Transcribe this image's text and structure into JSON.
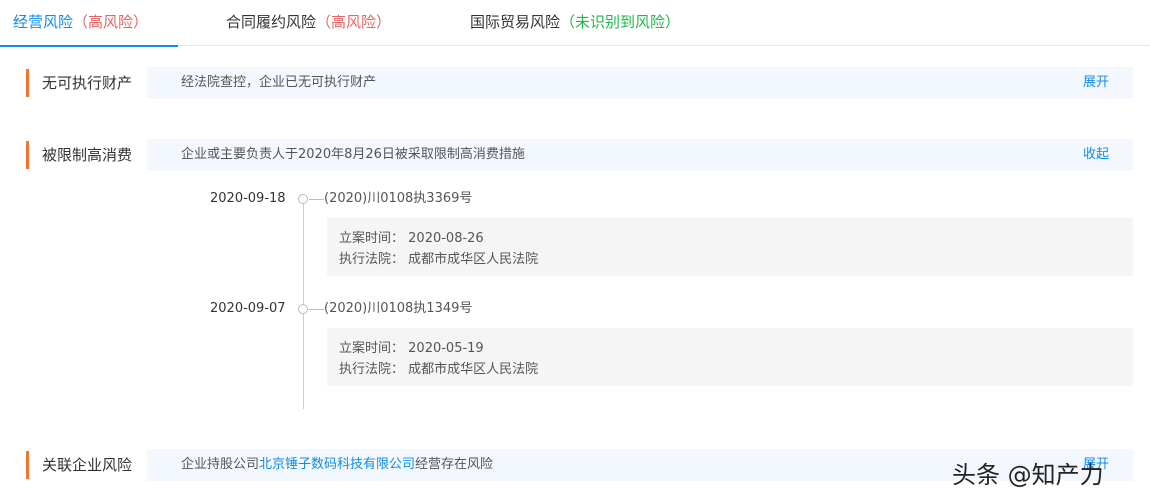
{
  "tabs": [
    {
      "label": "经营风险",
      "status": "（高风险）"
    },
    {
      "label": "合同履约风险",
      "status": "（高风险）"
    },
    {
      "label": "国际贸易风险",
      "status": "（未识别到风险）"
    }
  ],
  "sections": {
    "no_assets": {
      "title": "无可执行财产",
      "summary": "经法院查控，企业已无可执行财产",
      "toggle": "展开"
    },
    "consumption_limit": {
      "title": "被限制高消费",
      "summary": "企业或主要负责人于2020年8月26日被采取限制高消费措施",
      "toggle": "收起",
      "records": [
        {
          "date": "2020-09-18",
          "case_no": "(2020)川0108执3369号",
          "filing_label": "立案时间：",
          "filing_date": "2020-08-26",
          "court_label": "执行法院：",
          "court": "成都市成华区人民法院"
        },
        {
          "date": "2020-09-07",
          "case_no": "(2020)川0108执1349号",
          "filing_label": "立案时间：",
          "filing_date": "2020-05-19",
          "court_label": "执行法院：",
          "court": "成都市成华区人民法院"
        }
      ]
    },
    "related": {
      "title": "关联企业风险",
      "summary_prefix": "企业持股公司",
      "company": "北京锤子数码科技有限公司",
      "summary_suffix": "经营存在风险",
      "toggle": "展开"
    }
  },
  "watermark": "头条 @知产力",
  "colors": {
    "accent": "#128bed",
    "high_risk": "#e86464",
    "no_risk": "#1fb84a",
    "section_marker": "#f0752e"
  }
}
